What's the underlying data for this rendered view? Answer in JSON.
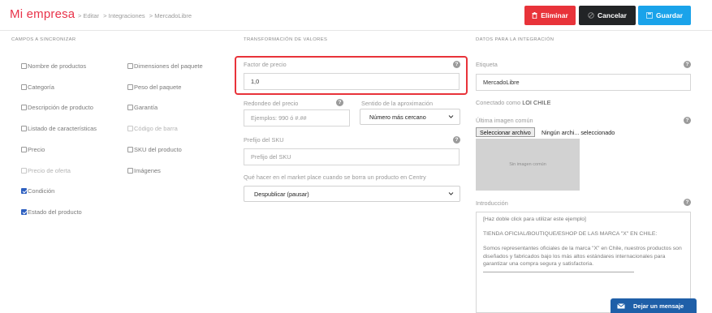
{
  "header": {
    "brand": "Mi empresa",
    "breadcrumb": [
      "> Editar",
      "> Integraciones",
      "> MercadoLibre"
    ],
    "delete_label": "Eliminar",
    "cancel_label": "Cancelar",
    "save_label": "Guardar"
  },
  "columns": {
    "sync": "CAMPOS A SINCRONIZAR",
    "transform": "TRANSFORMACIÓN DE VALORES",
    "integration": "DATOS PARA LA INTEGRACIÓN"
  },
  "sync_fields": {
    "left": [
      {
        "label": "Nombre de productos",
        "checked": false
      },
      {
        "label": "Categoría",
        "checked": false
      },
      {
        "label": "Descripción de producto",
        "checked": false
      },
      {
        "label": "Listado de características",
        "checked": false
      },
      {
        "label": "Precio",
        "checked": false
      },
      {
        "label": "Precio de oferta",
        "checked": false,
        "disabled": true
      },
      {
        "label": "Condición",
        "checked": true
      },
      {
        "label": "Estado del producto",
        "checked": true
      }
    ],
    "right": [
      {
        "label": "Dimensiones del paquete",
        "checked": false
      },
      {
        "label": "Peso del paquete",
        "checked": false
      },
      {
        "label": "Garantía",
        "checked": false
      },
      {
        "label": "Código de barra",
        "checked": false,
        "disabled": true
      },
      {
        "label": "SKU del producto",
        "checked": false
      },
      {
        "label": "Imágenes",
        "checked": false
      }
    ]
  },
  "transform": {
    "price_factor_label": "Factor de precio",
    "price_factor_value": "1,0",
    "rounding_label": "Redondeo del precio",
    "rounding_placeholder": "Ejemplos: 990 ó #.##",
    "approx_label": "Sentido de la aproximación",
    "approx_value": "Número más cercano",
    "sku_prefix_label": "Prefijo del SKU",
    "sku_prefix_placeholder": "Prefijo del SKU",
    "delete_action_label": "Qué hacer en el market place cuando se borra un producto en Centry",
    "delete_action_value": "Despublicar (pausar)"
  },
  "integration": {
    "label_label": "Etiqueta",
    "label_value": "MercadoLibre",
    "connected_prefix": "Conectado como",
    "connected_user": "LOI CHILE",
    "last_image_label": "Última imagen común",
    "file_button": "Seleccionar archivo",
    "file_status": "Ningún archi... seleccionado",
    "image_placeholder": "Sin imagen común",
    "intro_label": "Introducción",
    "intro_lines": [
      "[Haz doble click para utilizar este ejemplo]",
      "TIENDA OFICIAL/BOUTIQUE/ESHOP DE LAS MARCA \"X\" EN CHILE:",
      "Somos representantes oficiales de la marca \"X\" en Chile, nuestros productos son diseñados y fabricados bajo los más altos estándares internacionales para garantizar una compra segura y satisfactoria."
    ]
  },
  "chat": {
    "label": "Dejar un mensaje"
  },
  "icons": {
    "delete": "trash-icon",
    "cancel": "cancel-circle-icon",
    "save": "floppy-icon",
    "help": "question-circle-icon",
    "chevron": "chevron-down-icon",
    "chat": "envelope-icon"
  },
  "colors": {
    "brand": "#e8334a",
    "delete": "#e8333a",
    "cancel": "#222426",
    "save": "#1aa3ea",
    "checkbox_on": "#2d5fc0",
    "chat": "#1f5fa8"
  }
}
